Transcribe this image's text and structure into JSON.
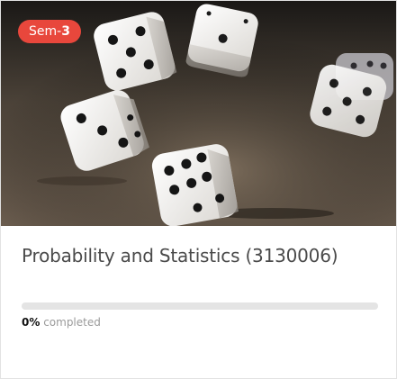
{
  "course": {
    "semester_prefix": "Sem-",
    "semester_number": "3",
    "title": "Probability and Statistics (3130006)",
    "progress_percent": 0,
    "progress_text": "0%",
    "progress_suffix": " completed",
    "image_subject": "dice-photo"
  },
  "colors": {
    "badge": "#e8473c",
    "title": "#4a4a4a",
    "progress_track": "#e4e4e4"
  }
}
